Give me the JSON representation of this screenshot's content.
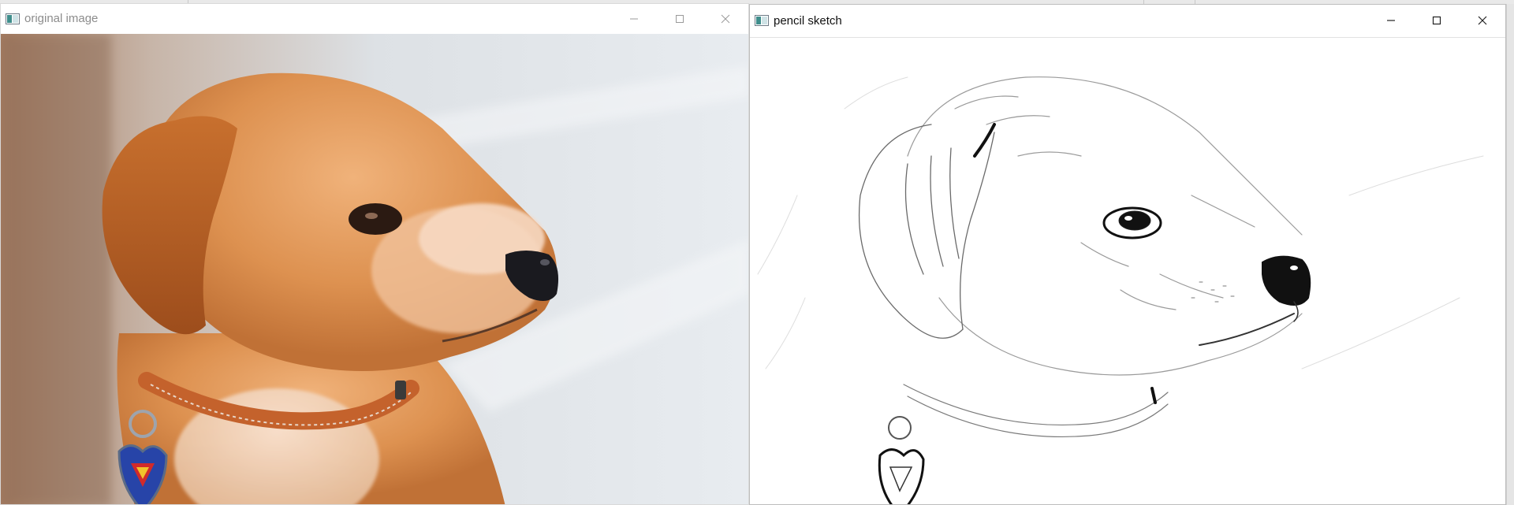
{
  "windows": {
    "original": {
      "title": "original image",
      "controls": {
        "minimize": "minimize-icon",
        "maximize": "maximize-icon",
        "close": "close-icon"
      }
    },
    "sketch": {
      "title": "pencil sketch",
      "controls": {
        "minimize": "minimize-icon",
        "maximize": "maximize-icon",
        "close": "close-icon"
      }
    }
  },
  "colors": {
    "fur": "#d98a45",
    "collar": "#c4622c",
    "tag_blue": "#2744a8",
    "nose": "#1a1a1f",
    "sketch_line": "#222222"
  }
}
